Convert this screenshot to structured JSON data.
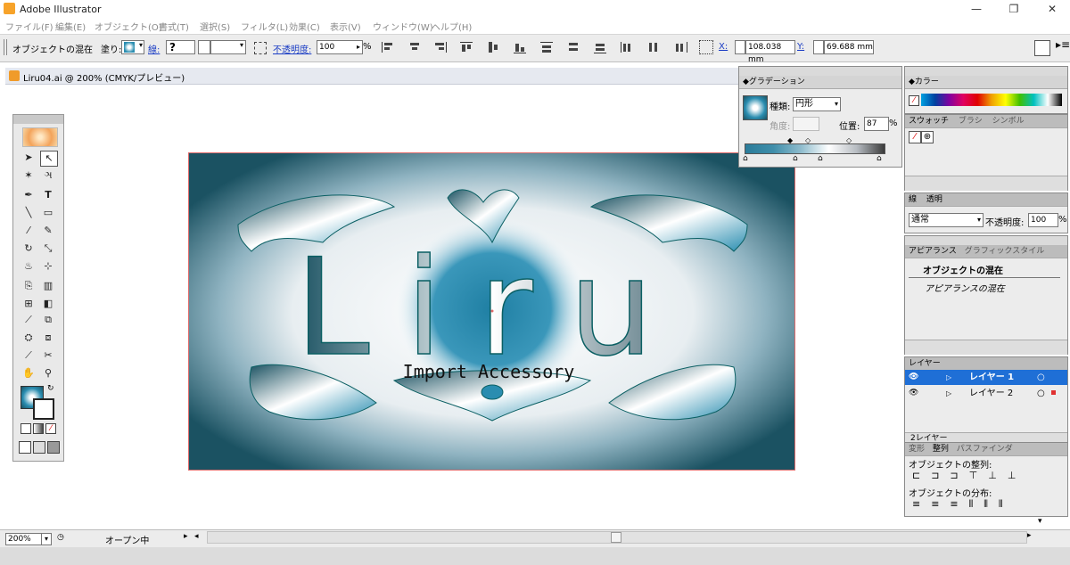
{
  "window": {
    "title": "Adobe Illustrator"
  },
  "menu": [
    "ファイル(F)",
    "編集(E)",
    "オブジェクト(O)",
    "書式(T)",
    "選択(S)",
    "フィルタ(L)",
    "効果(C)",
    "表示(V)",
    "ウィンドウ(W)",
    "ヘルプ(H)"
  ],
  "control": {
    "object_label": "オブジェクトの混在",
    "fill_label": "塗り:",
    "stroke_label": "線:",
    "stroke_value": "?",
    "opacity_label": "不透明度:",
    "opacity_value": "100",
    "percent": "%",
    "x_label": "X:",
    "x_value": "108.038 mm",
    "y_label": "Y:",
    "y_value": "69.688 mm"
  },
  "document": {
    "tab_title": "Liru04.ai @ 200% (CMYK/プレビュー)"
  },
  "artwork": {
    "main_text": "Liru",
    "sub_text": "Import Accessory"
  },
  "gradient_panel": {
    "title": "グラデーション",
    "type_label": "種類:",
    "type_value": "円形",
    "angle_label": "角度:",
    "position_label": "位置:",
    "position_value": "87",
    "percent": "%",
    "ramp_colors": [
      "#2b7c9a",
      "#3f8eaa",
      "#8fbccd",
      "#ffffff",
      "#b7bcc2",
      "#3b3b3b"
    ]
  },
  "color_panel": {
    "title": "カラー"
  },
  "swatch_tabs": [
    "スウォッチ",
    "ブラシ",
    "シンボル"
  ],
  "transparency_panel": {
    "tabs": [
      "線",
      "透明"
    ],
    "blend_mode": "通常",
    "opacity_label": "不透明度:",
    "opacity_value": "100",
    "percent": "%"
  },
  "appearance_panel": {
    "tabs": [
      "アピアランス",
      "グラフィックスタイル"
    ],
    "item1": "オブジェクトの混在",
    "item2": "アピアランスの混在"
  },
  "layers_panel": {
    "title": "レイヤー",
    "layers": [
      {
        "name": "レイヤー 1",
        "selected": true
      },
      {
        "name": "レイヤー 2",
        "selected": false
      }
    ],
    "count": "2レイヤー"
  },
  "align_panel": {
    "tabs": [
      "変形",
      "整列",
      "パスファインダ"
    ],
    "align_label": "オブジェクトの整列:",
    "distribute_label": "オブジェクトの分布:"
  },
  "status": {
    "zoom": "200%",
    "text": "オープン中"
  },
  "colors": {
    "art_dark": "#1b5262",
    "art_mid": "#2a8db0",
    "selection": "#e06a6a",
    "layer_highlight": "#1f6fd6"
  }
}
